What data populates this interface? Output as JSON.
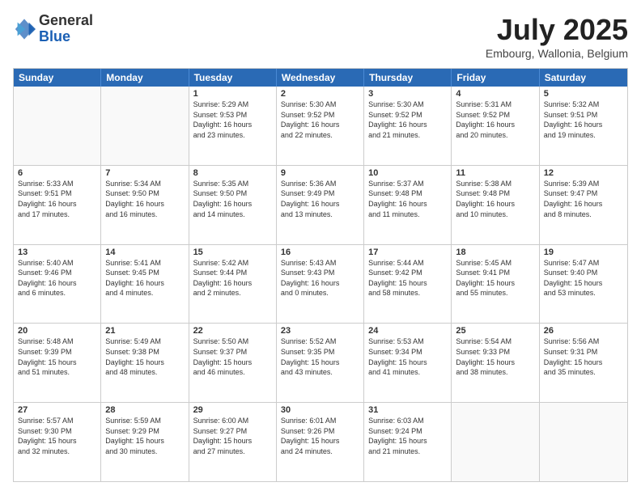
{
  "logo": {
    "general": "General",
    "blue": "Blue"
  },
  "title": "July 2025",
  "location": "Embourg, Wallonia, Belgium",
  "days": [
    "Sunday",
    "Monday",
    "Tuesday",
    "Wednesday",
    "Thursday",
    "Friday",
    "Saturday"
  ],
  "weeks": [
    [
      {
        "day": "",
        "info": ""
      },
      {
        "day": "",
        "info": ""
      },
      {
        "day": "1",
        "info": "Sunrise: 5:29 AM\nSunset: 9:53 PM\nDaylight: 16 hours\nand 23 minutes."
      },
      {
        "day": "2",
        "info": "Sunrise: 5:30 AM\nSunset: 9:52 PM\nDaylight: 16 hours\nand 22 minutes."
      },
      {
        "day": "3",
        "info": "Sunrise: 5:30 AM\nSunset: 9:52 PM\nDaylight: 16 hours\nand 21 minutes."
      },
      {
        "day": "4",
        "info": "Sunrise: 5:31 AM\nSunset: 9:52 PM\nDaylight: 16 hours\nand 20 minutes."
      },
      {
        "day": "5",
        "info": "Sunrise: 5:32 AM\nSunset: 9:51 PM\nDaylight: 16 hours\nand 19 minutes."
      }
    ],
    [
      {
        "day": "6",
        "info": "Sunrise: 5:33 AM\nSunset: 9:51 PM\nDaylight: 16 hours\nand 17 minutes."
      },
      {
        "day": "7",
        "info": "Sunrise: 5:34 AM\nSunset: 9:50 PM\nDaylight: 16 hours\nand 16 minutes."
      },
      {
        "day": "8",
        "info": "Sunrise: 5:35 AM\nSunset: 9:50 PM\nDaylight: 16 hours\nand 14 minutes."
      },
      {
        "day": "9",
        "info": "Sunrise: 5:36 AM\nSunset: 9:49 PM\nDaylight: 16 hours\nand 13 minutes."
      },
      {
        "day": "10",
        "info": "Sunrise: 5:37 AM\nSunset: 9:48 PM\nDaylight: 16 hours\nand 11 minutes."
      },
      {
        "day": "11",
        "info": "Sunrise: 5:38 AM\nSunset: 9:48 PM\nDaylight: 16 hours\nand 10 minutes."
      },
      {
        "day": "12",
        "info": "Sunrise: 5:39 AM\nSunset: 9:47 PM\nDaylight: 16 hours\nand 8 minutes."
      }
    ],
    [
      {
        "day": "13",
        "info": "Sunrise: 5:40 AM\nSunset: 9:46 PM\nDaylight: 16 hours\nand 6 minutes."
      },
      {
        "day": "14",
        "info": "Sunrise: 5:41 AM\nSunset: 9:45 PM\nDaylight: 16 hours\nand 4 minutes."
      },
      {
        "day": "15",
        "info": "Sunrise: 5:42 AM\nSunset: 9:44 PM\nDaylight: 16 hours\nand 2 minutes."
      },
      {
        "day": "16",
        "info": "Sunrise: 5:43 AM\nSunset: 9:43 PM\nDaylight: 16 hours\nand 0 minutes."
      },
      {
        "day": "17",
        "info": "Sunrise: 5:44 AM\nSunset: 9:42 PM\nDaylight: 15 hours\nand 58 minutes."
      },
      {
        "day": "18",
        "info": "Sunrise: 5:45 AM\nSunset: 9:41 PM\nDaylight: 15 hours\nand 55 minutes."
      },
      {
        "day": "19",
        "info": "Sunrise: 5:47 AM\nSunset: 9:40 PM\nDaylight: 15 hours\nand 53 minutes."
      }
    ],
    [
      {
        "day": "20",
        "info": "Sunrise: 5:48 AM\nSunset: 9:39 PM\nDaylight: 15 hours\nand 51 minutes."
      },
      {
        "day": "21",
        "info": "Sunrise: 5:49 AM\nSunset: 9:38 PM\nDaylight: 15 hours\nand 48 minutes."
      },
      {
        "day": "22",
        "info": "Sunrise: 5:50 AM\nSunset: 9:37 PM\nDaylight: 15 hours\nand 46 minutes."
      },
      {
        "day": "23",
        "info": "Sunrise: 5:52 AM\nSunset: 9:35 PM\nDaylight: 15 hours\nand 43 minutes."
      },
      {
        "day": "24",
        "info": "Sunrise: 5:53 AM\nSunset: 9:34 PM\nDaylight: 15 hours\nand 41 minutes."
      },
      {
        "day": "25",
        "info": "Sunrise: 5:54 AM\nSunset: 9:33 PM\nDaylight: 15 hours\nand 38 minutes."
      },
      {
        "day": "26",
        "info": "Sunrise: 5:56 AM\nSunset: 9:31 PM\nDaylight: 15 hours\nand 35 minutes."
      }
    ],
    [
      {
        "day": "27",
        "info": "Sunrise: 5:57 AM\nSunset: 9:30 PM\nDaylight: 15 hours\nand 32 minutes."
      },
      {
        "day": "28",
        "info": "Sunrise: 5:59 AM\nSunset: 9:29 PM\nDaylight: 15 hours\nand 30 minutes."
      },
      {
        "day": "29",
        "info": "Sunrise: 6:00 AM\nSunset: 9:27 PM\nDaylight: 15 hours\nand 27 minutes."
      },
      {
        "day": "30",
        "info": "Sunrise: 6:01 AM\nSunset: 9:26 PM\nDaylight: 15 hours\nand 24 minutes."
      },
      {
        "day": "31",
        "info": "Sunrise: 6:03 AM\nSunset: 9:24 PM\nDaylight: 15 hours\nand 21 minutes."
      },
      {
        "day": "",
        "info": ""
      },
      {
        "day": "",
        "info": ""
      }
    ]
  ]
}
